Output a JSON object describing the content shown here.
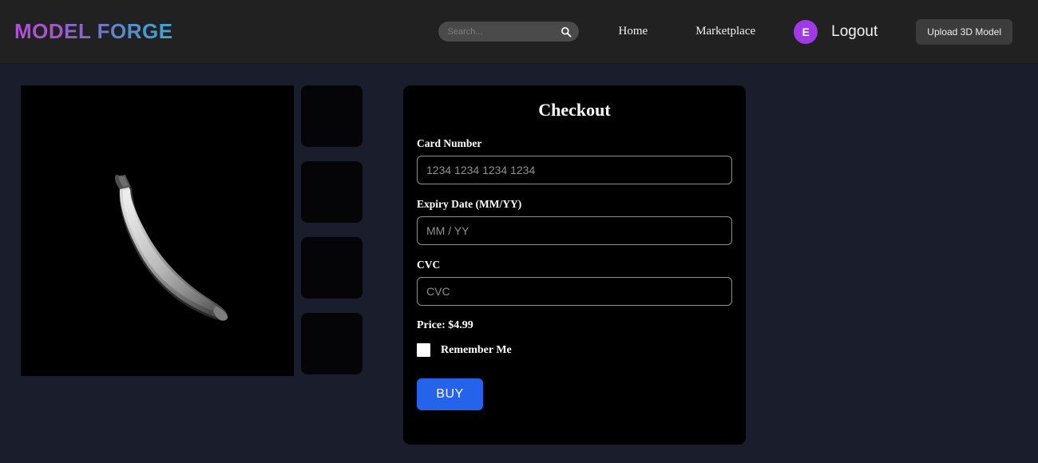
{
  "header": {
    "logo_part1": "MODEL",
    "logo_part2": " FORGE",
    "search": {
      "value": "",
      "placeholder": "Search...",
      "icon": "search-icon"
    },
    "nav": [
      {
        "label": "Home"
      },
      {
        "label": "Marketplace"
      }
    ],
    "avatar_initial": "E",
    "logout_label": "Logout",
    "upload_label": "Upload 3D Model",
    "colors": {
      "header_bg": "#212121",
      "avatar_bg": "#a03ae8",
      "upload_bg": "#3c3c3c",
      "logo_gradient_start": "#b14fd8",
      "logo_gradient_end": "#3fa8d8"
    }
  },
  "viewer": {
    "model_name": "banana-3d-model",
    "background": "#000000",
    "thumbnails": [
      {
        "label": ""
      },
      {
        "label": ""
      },
      {
        "label": ""
      },
      {
        "label": ""
      }
    ]
  },
  "checkout": {
    "title": "Checkout",
    "fields": [
      {
        "label": "Card Number",
        "value": "",
        "placeholder": "1234 1234 1234 1234",
        "name": "card-number"
      },
      {
        "label": "Expiry Date (MM/YY)",
        "value": "",
        "placeholder": "MM / YY",
        "name": "expiry-date"
      },
      {
        "label": "CVC",
        "value": "",
        "placeholder": "CVC",
        "name": "cvc"
      }
    ],
    "price_text": "Price: $4.99",
    "remember_label": "Remember Me",
    "remember_checked": false,
    "buy_label": "BUY",
    "colors": {
      "panel_bg": "#000000",
      "buy_bg": "#2563eb",
      "input_border": "#8f8f8f"
    }
  },
  "page": {
    "background": "#1a1d2b"
  }
}
